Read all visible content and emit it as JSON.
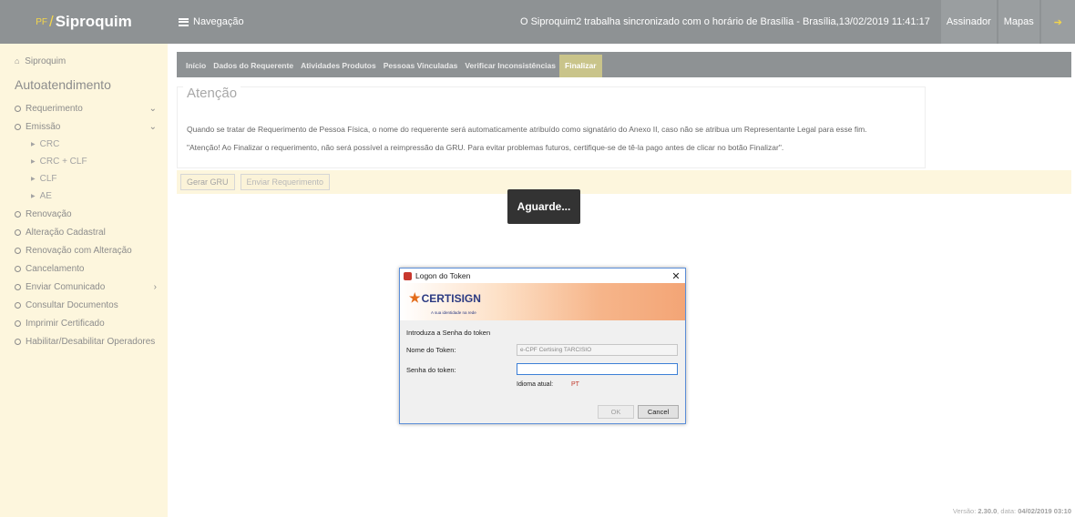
{
  "brand": {
    "prefix": "PF",
    "slash": "/",
    "name": "Siproquim"
  },
  "topbar": {
    "nav_label": "Navegação",
    "sync_message": "O Siproquim2 trabalha sincronizado com o horário de Brasília - Brasília,13/02/2019 11:41:17",
    "buttons": [
      "Assinador",
      "Mapas"
    ],
    "exit_icon": "sign-out-icon"
  },
  "sidebar": {
    "home_label": "Siproquim",
    "section_title": "Autoatendimento",
    "items": [
      {
        "label": "Requerimento",
        "chevron": "⌄"
      },
      {
        "label": "Emissão",
        "chevron": "⌄"
      },
      {
        "label": "Renovação",
        "chevron": ""
      },
      {
        "label": "Alteração Cadastral",
        "chevron": ""
      },
      {
        "label": "Renovação com Alteração",
        "chevron": ""
      },
      {
        "label": "Cancelamento",
        "chevron": ""
      },
      {
        "label": "Enviar Comunicado",
        "chevron": "›"
      },
      {
        "label": "Consultar Documentos",
        "chevron": ""
      },
      {
        "label": "Imprimir Certificado",
        "chevron": ""
      },
      {
        "label": "Habilitar/Desabilitar Operadores",
        "chevron": ""
      }
    ],
    "emissao_sub": [
      "CRC",
      "CRC + CLF",
      "CLF",
      "AE"
    ]
  },
  "tabs": [
    "Início",
    "Dados do Requerente",
    "Atividades Produtos",
    "Pessoas Vinculadas",
    "Verificar Inconsistências",
    "Finalizar"
  ],
  "attention": {
    "legend": "Atenção",
    "line1": "Quando se tratar de Requerimento de Pessoa Física, o nome do requerente será automaticamente atribuído como signatário do Anexo II, caso não se atribua um Representante Legal para esse fim.",
    "line2": "\"Atenção! Ao Finalizar o requerimento, não será possível a reimpressão da GRU. Para evitar problemas futuros, certifique-se de tê-la pago antes de clicar no botão Finalizar\"."
  },
  "actions": {
    "gerar": "Gerar GRU",
    "enviar": "Enviar Requerimento"
  },
  "overlay": {
    "aguarde": "Aguarde..."
  },
  "dialog": {
    "title": "Logon do Token",
    "close": "✕",
    "logo": "CERTISIGN",
    "logo_tagline": "A sua identidade na rede",
    "intro": "Introduza a Senha do token",
    "token_name_label": "Nome do Token:",
    "token_name_value": "e-CPF Certising TARCISIO",
    "password_label": "Senha do token:",
    "password_value": "",
    "lang_label": "Idioma atual:",
    "lang_value": "PT",
    "ok": "OK",
    "cancel": "Cancel"
  },
  "version": {
    "prefix": "Versão: ",
    "number": "2.30.0",
    "mid": ", data: ",
    "date": "04/02/2019 03:10"
  },
  "colors": {
    "topbar": "#8e9294",
    "sidebar": "#fdf6dd",
    "accent": "#f4d64a",
    "active_tab": "#c9c48a"
  }
}
